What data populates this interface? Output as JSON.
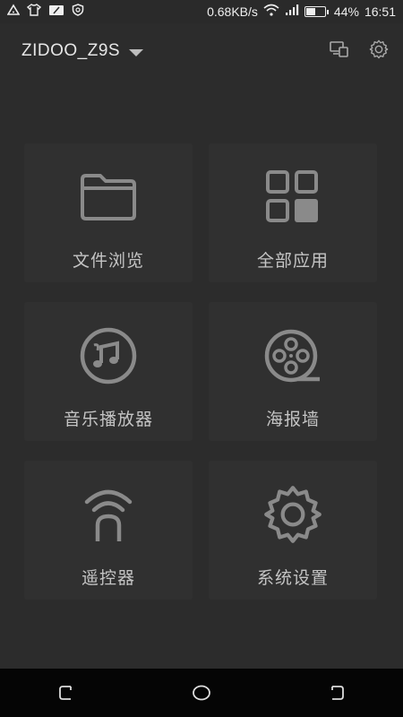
{
  "status_bar": {
    "net_speed": "0.68KB/s",
    "battery": "44%",
    "battery_level": 0.44,
    "time": "16:51",
    "left_icons": [
      "alert-triangle-icon",
      "tshirt-icon",
      "sim-card-icon",
      "shield-icon"
    ],
    "right_icons": [
      "wifi-icon",
      "signal-icon",
      "battery-icon"
    ]
  },
  "header": {
    "device_name": "ZIDOO_Z9S",
    "icons": [
      "cast-screen-icon",
      "settings-gear-icon"
    ]
  },
  "tiles": [
    {
      "label": "文件浏览",
      "icon": "folder-icon"
    },
    {
      "label": "全部应用",
      "icon": "apps-grid-icon"
    },
    {
      "label": "音乐播放器",
      "icon": "music-note-icon"
    },
    {
      "label": "海报墙",
      "icon": "film-reel-icon"
    },
    {
      "label": "遥控器",
      "icon": "remote-signal-icon"
    },
    {
      "label": "系统设置",
      "icon": "settings-gear-icon"
    }
  ],
  "navbar": {
    "buttons": [
      "recent-apps-icon",
      "home-icon",
      "back-icon"
    ]
  },
  "colors": {
    "background": "#2c2c2c",
    "tile": "#303030",
    "icon": "#8a8a8a",
    "navbar": "#050505"
  }
}
